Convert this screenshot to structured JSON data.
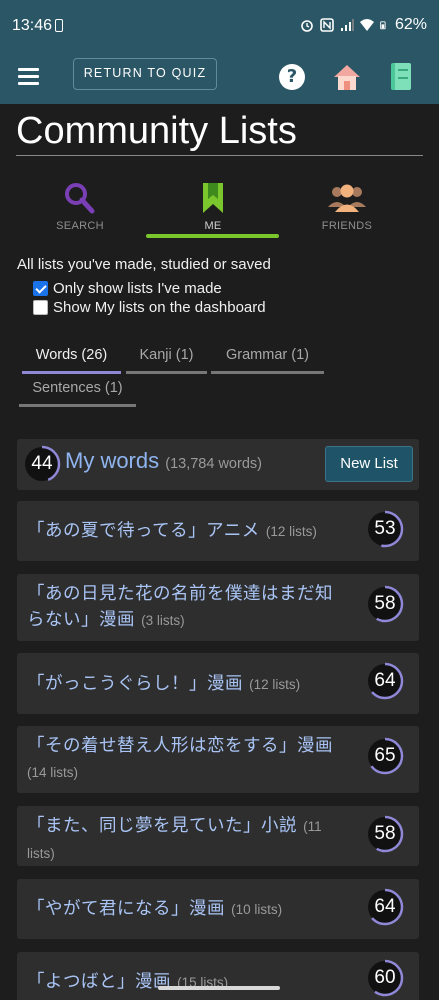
{
  "status_bar": {
    "time": "13:46",
    "battery": "62%"
  },
  "nav": {
    "return_label": "RETURN TO QUIZ",
    "help_glyph": "?"
  },
  "page": {
    "title": "Community Lists"
  },
  "tabs": [
    {
      "label": "SEARCH",
      "icon": "search-icon"
    },
    {
      "label": "ME",
      "icon": "bookmark-icon"
    },
    {
      "label": "FRIENDS",
      "icon": "friends-icon"
    }
  ],
  "description": "All lists you've made, studied or saved",
  "options": {
    "only_mine": {
      "label": "Only show lists I've made",
      "checked": true
    },
    "show_dashboard": {
      "label": "Show My lists on the dashboard",
      "checked": false
    }
  },
  "subtabs": [
    {
      "label": "Words (26)"
    },
    {
      "label": "Kanji (1)"
    },
    {
      "label": "Grammar (1)"
    },
    {
      "label": "Sentences (1)"
    }
  ],
  "my_words": {
    "score": "44",
    "title": "My words",
    "count": "(13,784 words)",
    "new_list_label": "New List"
  },
  "lists": [
    {
      "title": "「あの夏で待ってる」アニメ",
      "count": "(12 lists)",
      "score": "53"
    },
    {
      "title": "「あの日見た花の名前を僕達はまだ知らない」漫画",
      "count": "(3 lists)",
      "score": "58"
    },
    {
      "title": "「がっこうぐらし！」漫画",
      "count": "(12 lists)",
      "score": "64"
    },
    {
      "title": "「その着せ替え人形は恋をする」漫画",
      "count": "(14 lists)",
      "score": "65"
    },
    {
      "title": "「また、同じ夢を見ていた」小説",
      "count": "(11 lists)",
      "score": "58"
    },
    {
      "title": "「やがて君になる」漫画",
      "count": "(10 lists)",
      "score": "64"
    },
    {
      "title": "「よつばと」漫画",
      "count": "(15 lists)",
      "score": "60"
    }
  ],
  "colors": {
    "header": "#2a5665",
    "accent_green": "#7bc62d",
    "ring": "#8f88d6",
    "link": "#a9c4f5"
  }
}
